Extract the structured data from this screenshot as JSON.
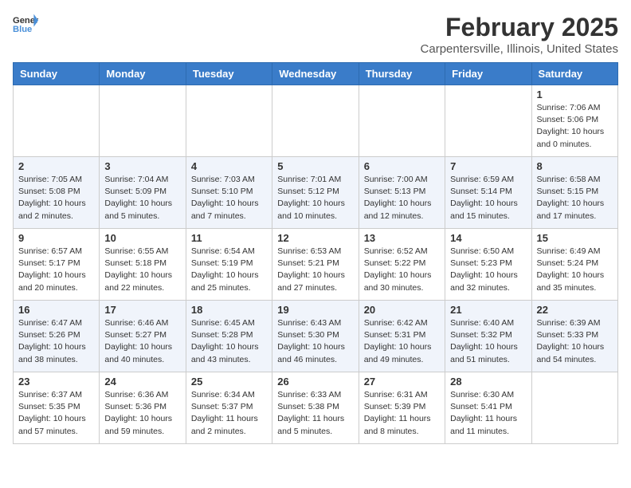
{
  "header": {
    "logo_general": "General",
    "logo_blue": "Blue",
    "title": "February 2025",
    "subtitle": "Carpentersville, Illinois, United States"
  },
  "weekdays": [
    "Sunday",
    "Monday",
    "Tuesday",
    "Wednesday",
    "Thursday",
    "Friday",
    "Saturday"
  ],
  "weeks": [
    [
      {
        "day": "",
        "info": ""
      },
      {
        "day": "",
        "info": ""
      },
      {
        "day": "",
        "info": ""
      },
      {
        "day": "",
        "info": ""
      },
      {
        "day": "",
        "info": ""
      },
      {
        "day": "",
        "info": ""
      },
      {
        "day": "1",
        "info": "Sunrise: 7:06 AM\nSunset: 5:06 PM\nDaylight: 10 hours\nand 0 minutes."
      }
    ],
    [
      {
        "day": "2",
        "info": "Sunrise: 7:05 AM\nSunset: 5:08 PM\nDaylight: 10 hours\nand 2 minutes."
      },
      {
        "day": "3",
        "info": "Sunrise: 7:04 AM\nSunset: 5:09 PM\nDaylight: 10 hours\nand 5 minutes."
      },
      {
        "day": "4",
        "info": "Sunrise: 7:03 AM\nSunset: 5:10 PM\nDaylight: 10 hours\nand 7 minutes."
      },
      {
        "day": "5",
        "info": "Sunrise: 7:01 AM\nSunset: 5:12 PM\nDaylight: 10 hours\nand 10 minutes."
      },
      {
        "day": "6",
        "info": "Sunrise: 7:00 AM\nSunset: 5:13 PM\nDaylight: 10 hours\nand 12 minutes."
      },
      {
        "day": "7",
        "info": "Sunrise: 6:59 AM\nSunset: 5:14 PM\nDaylight: 10 hours\nand 15 minutes."
      },
      {
        "day": "8",
        "info": "Sunrise: 6:58 AM\nSunset: 5:15 PM\nDaylight: 10 hours\nand 17 minutes."
      }
    ],
    [
      {
        "day": "9",
        "info": "Sunrise: 6:57 AM\nSunset: 5:17 PM\nDaylight: 10 hours\nand 20 minutes."
      },
      {
        "day": "10",
        "info": "Sunrise: 6:55 AM\nSunset: 5:18 PM\nDaylight: 10 hours\nand 22 minutes."
      },
      {
        "day": "11",
        "info": "Sunrise: 6:54 AM\nSunset: 5:19 PM\nDaylight: 10 hours\nand 25 minutes."
      },
      {
        "day": "12",
        "info": "Sunrise: 6:53 AM\nSunset: 5:21 PM\nDaylight: 10 hours\nand 27 minutes."
      },
      {
        "day": "13",
        "info": "Sunrise: 6:52 AM\nSunset: 5:22 PM\nDaylight: 10 hours\nand 30 minutes."
      },
      {
        "day": "14",
        "info": "Sunrise: 6:50 AM\nSunset: 5:23 PM\nDaylight: 10 hours\nand 32 minutes."
      },
      {
        "day": "15",
        "info": "Sunrise: 6:49 AM\nSunset: 5:24 PM\nDaylight: 10 hours\nand 35 minutes."
      }
    ],
    [
      {
        "day": "16",
        "info": "Sunrise: 6:47 AM\nSunset: 5:26 PM\nDaylight: 10 hours\nand 38 minutes."
      },
      {
        "day": "17",
        "info": "Sunrise: 6:46 AM\nSunset: 5:27 PM\nDaylight: 10 hours\nand 40 minutes."
      },
      {
        "day": "18",
        "info": "Sunrise: 6:45 AM\nSunset: 5:28 PM\nDaylight: 10 hours\nand 43 minutes."
      },
      {
        "day": "19",
        "info": "Sunrise: 6:43 AM\nSunset: 5:30 PM\nDaylight: 10 hours\nand 46 minutes."
      },
      {
        "day": "20",
        "info": "Sunrise: 6:42 AM\nSunset: 5:31 PM\nDaylight: 10 hours\nand 49 minutes."
      },
      {
        "day": "21",
        "info": "Sunrise: 6:40 AM\nSunset: 5:32 PM\nDaylight: 10 hours\nand 51 minutes."
      },
      {
        "day": "22",
        "info": "Sunrise: 6:39 AM\nSunset: 5:33 PM\nDaylight: 10 hours\nand 54 minutes."
      }
    ],
    [
      {
        "day": "23",
        "info": "Sunrise: 6:37 AM\nSunset: 5:35 PM\nDaylight: 10 hours\nand 57 minutes."
      },
      {
        "day": "24",
        "info": "Sunrise: 6:36 AM\nSunset: 5:36 PM\nDaylight: 10 hours\nand 59 minutes."
      },
      {
        "day": "25",
        "info": "Sunrise: 6:34 AM\nSunset: 5:37 PM\nDaylight: 11 hours\nand 2 minutes."
      },
      {
        "day": "26",
        "info": "Sunrise: 6:33 AM\nSunset: 5:38 PM\nDaylight: 11 hours\nand 5 minutes."
      },
      {
        "day": "27",
        "info": "Sunrise: 6:31 AM\nSunset: 5:39 PM\nDaylight: 11 hours\nand 8 minutes."
      },
      {
        "day": "28",
        "info": "Sunrise: 6:30 AM\nSunset: 5:41 PM\nDaylight: 11 hours\nand 11 minutes."
      },
      {
        "day": "",
        "info": ""
      }
    ]
  ]
}
